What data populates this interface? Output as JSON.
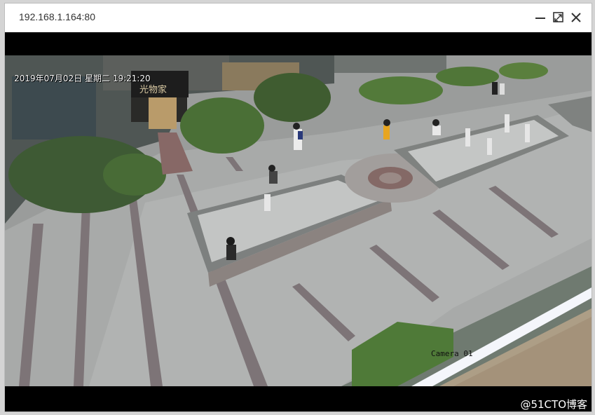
{
  "window": {
    "title": "192.168.1.164:80",
    "controls": {
      "minimize_icon": "minimize-icon",
      "maximize_icon": "maximize-icon",
      "close_icon": "close-icon"
    }
  },
  "video": {
    "timestamp": "2019年07月02日 星期二 19:21:20",
    "camera_label": "Camera 01",
    "storefront_sign": "光物家"
  },
  "watermark": "@51CTO博客"
}
